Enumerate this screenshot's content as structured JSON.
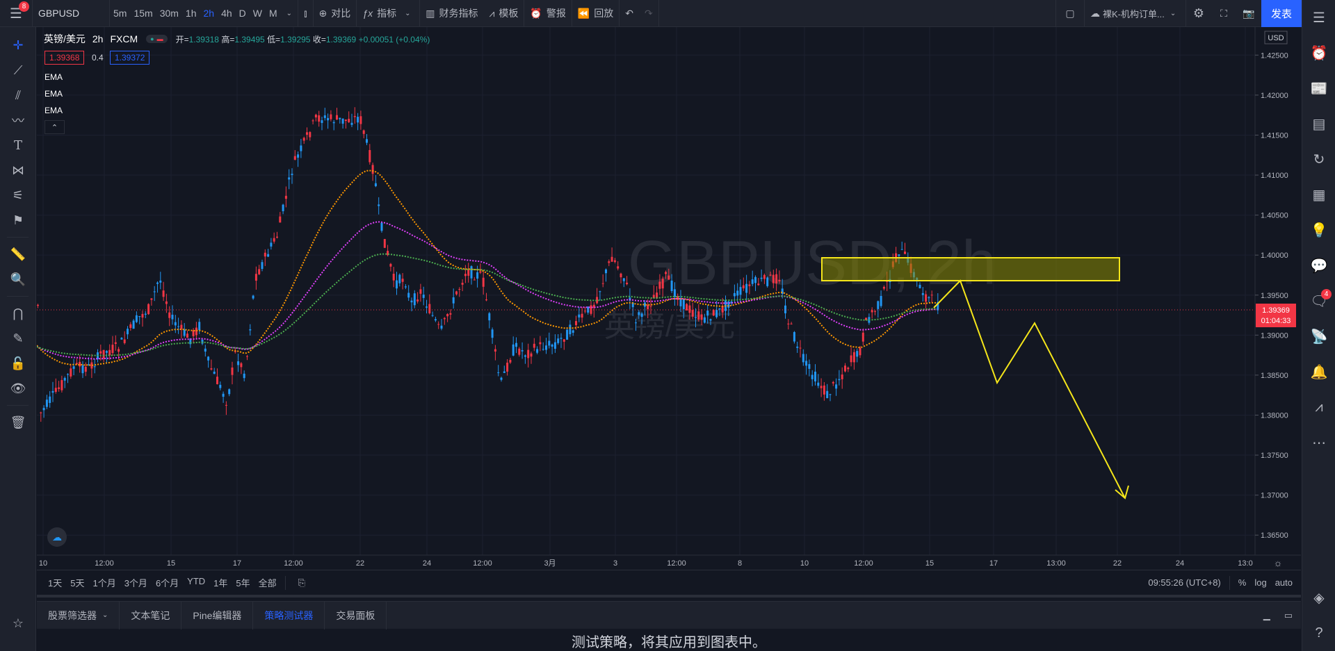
{
  "topbar": {
    "menu_badge": "8",
    "symbol": "GBPUSD",
    "intervals": [
      "5m",
      "15m",
      "30m",
      "1h",
      "2h",
      "4h",
      "D",
      "W",
      "M"
    ],
    "active_interval": "2h",
    "compare": "对比",
    "indicators": "指标",
    "financials": "财务指标",
    "templates": "模板",
    "alert": "警报",
    "replay": "回放",
    "layout_name": "裸K-机构订单...",
    "publish": "发表"
  },
  "legend": {
    "title": "英镑/美元",
    "interval": "2h",
    "exchange": "FXCM",
    "open_label": "开=",
    "open": "1.39318",
    "high_label": "高=",
    "high": "1.39495",
    "low_label": "低=",
    "low": "1.39295",
    "close_label": "收=",
    "close": "1.39369",
    "change": "+0.00051 (+0.04%)",
    "bid": "1.39368",
    "spread": "0.4",
    "ask": "1.39372",
    "ema_labels": [
      "EMA",
      "EMA",
      "EMA"
    ]
  },
  "watermark": {
    "symbol": "GBPUSD, 2h",
    "name": "英镑/美元"
  },
  "price_axis": {
    "currency": "USD",
    "ticks": [
      "1.42500",
      "1.42000",
      "1.41500",
      "1.41000",
      "1.40500",
      "1.40000",
      "1.39500",
      "1.39000",
      "1.38500",
      "1.38000",
      "1.37500",
      "1.37000",
      "1.36500"
    ],
    "last_price": "1.39369",
    "countdown": "01:04:33"
  },
  "time_axis": {
    "ticks": [
      "10",
      "12:00",
      "15",
      "17",
      "12:00",
      "22",
      "24",
      "12:00",
      "3月",
      "3",
      "12:00",
      "8",
      "10",
      "12:00",
      "15",
      "17",
      "13:00",
      "22",
      "24",
      "13:0"
    ]
  },
  "timebar": {
    "ranges": [
      "1天",
      "5天",
      "1个月",
      "3个月",
      "6个月",
      "YTD",
      "1年",
      "5年",
      "全部"
    ],
    "clock": "09:55:26 (UTC+8)",
    "percent": "%",
    "log": "log",
    "auto": "auto"
  },
  "bottom_tabs": [
    "股票筛选器",
    "文本笔记",
    "Pine编辑器",
    "策略测试器",
    "交易面板"
  ],
  "active_bottom_tab": "策略测试器",
  "panel_message": "测试策略，将其应用到图表中。",
  "right_badge": "4",
  "colors": {
    "up": "#2196f3",
    "down": "#f23645",
    "ema_fast": "#ff9800",
    "ema_mid": "#e040fb",
    "ema_slow": "#4caf50",
    "zone": "#f5e61a",
    "bg": "#131722"
  },
  "chart_data": {
    "type": "candlestick",
    "ylim": [
      1.3625,
      1.4285
    ],
    "key_levels": {
      "zone_top": 1.4002,
      "zone_bottom": 1.3975
    },
    "projection_path": [
      1.3937,
      1.3975,
      1.385,
      1.392,
      1.3685
    ]
  }
}
